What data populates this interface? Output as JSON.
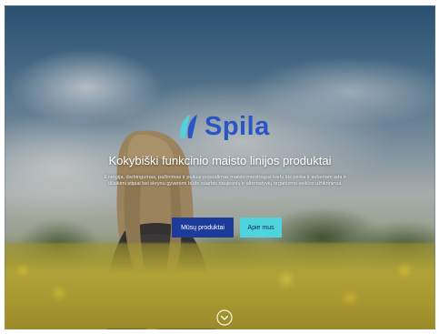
{
  "brand": {
    "name": "Spila",
    "logo_icon": "spila-leaf-logo-icon",
    "color": "#2a55c7"
  },
  "hero": {
    "tagline": "Kokybiški funkcinio maisto linijos produktai",
    "description": "Energija, darbingumas, pažinimas ir puikus pojaudimas maisto meistrugus karlu šis pėrka ir suberiam ada ir išlaikimi stipiai bei skrynu gyvenimi būdo suarbis naujesnių ir alternatyvių organizmo veiklos užtikrinimui."
  },
  "buttons": {
    "primary_label": "Mūsų produktai",
    "secondary_label": "Apie mus"
  },
  "icons": {
    "scroll": "chevron-down-circle-icon"
  },
  "colors": {
    "primary_button": "#1c3b9a",
    "secondary_button": "#4fd3df"
  }
}
